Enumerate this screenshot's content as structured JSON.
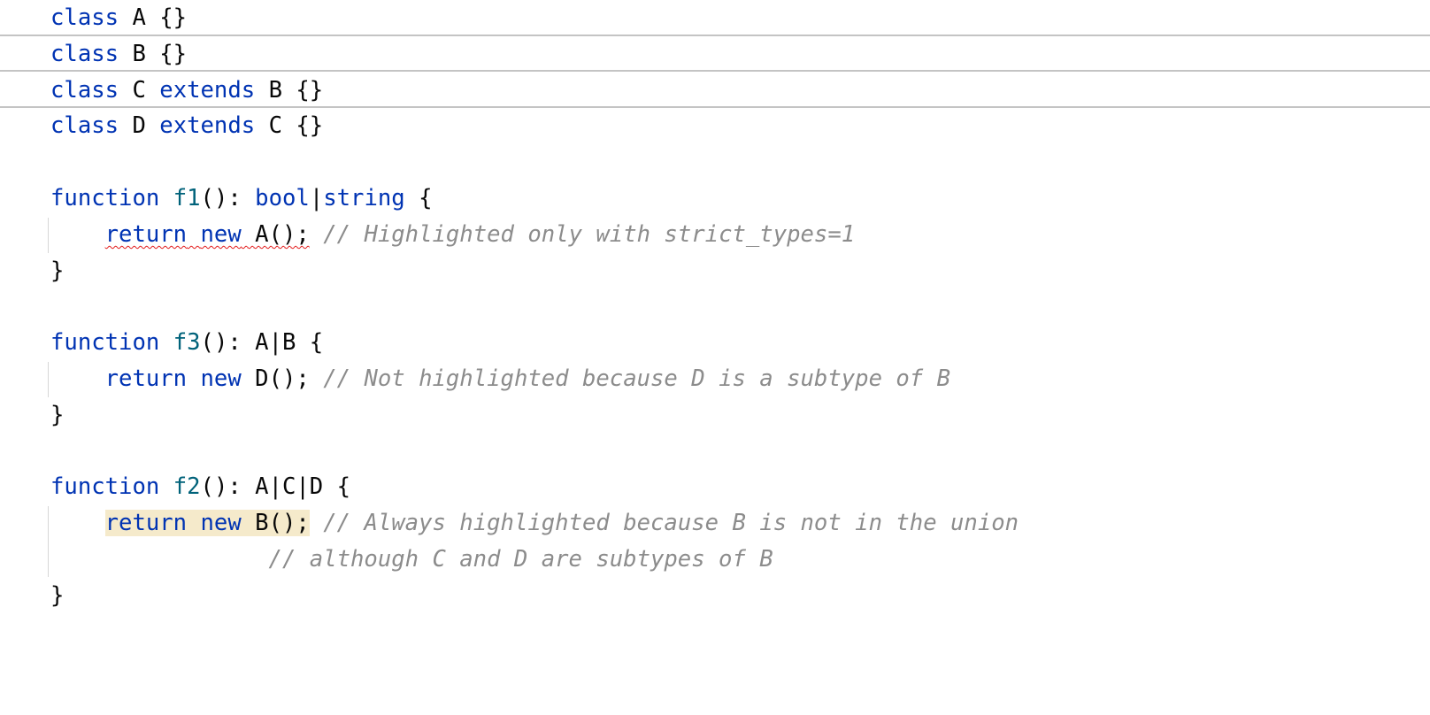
{
  "editor": {
    "lines": [
      {
        "tokens": [
          {
            "t": "kw",
            "v": "class"
          },
          {
            "t": "id",
            "v": " A {}"
          }
        ]
      },
      {
        "tokens": [
          {
            "t": "kw",
            "v": "class"
          },
          {
            "t": "id",
            "v": " B {}"
          }
        ]
      },
      {
        "tokens": [
          {
            "t": "kw",
            "v": "class"
          },
          {
            "t": "id",
            "v": " C "
          },
          {
            "t": "kw",
            "v": "extends"
          },
          {
            "t": "id",
            "v": " B {}"
          }
        ]
      },
      {
        "tokens": [
          {
            "t": "kw",
            "v": "class"
          },
          {
            "t": "id",
            "v": " D "
          },
          {
            "t": "kw",
            "v": "extends"
          },
          {
            "t": "id",
            "v": " C {}"
          }
        ]
      },
      {
        "tokens": []
      },
      {
        "tokens": [
          {
            "t": "kw",
            "v": "function"
          },
          {
            "t": "id",
            "v": " "
          },
          {
            "t": "fn",
            "v": "f1"
          },
          {
            "t": "id",
            "v": "(): "
          },
          {
            "t": "kw",
            "v": "bool"
          },
          {
            "t": "id",
            "v": "|"
          },
          {
            "t": "kw",
            "v": "string"
          },
          {
            "t": "id",
            "v": " {"
          }
        ]
      },
      {
        "tokens": [
          {
            "t": "id",
            "v": "    "
          },
          {
            "t": "kw",
            "v": "return"
          },
          {
            "t": "id",
            "v": " "
          },
          {
            "t": "kw",
            "v": "new"
          },
          {
            "t": "id",
            "v": " A();"
          },
          {
            "t": "id",
            "v": " "
          },
          {
            "t": "cm",
            "v": "// Highlighted only with strict_types=1"
          }
        ],
        "error_span": [
          1,
          4
        ]
      },
      {
        "tokens": [
          {
            "t": "id",
            "v": "}"
          }
        ]
      },
      {
        "tokens": []
      },
      {
        "tokens": [
          {
            "t": "kw",
            "v": "function"
          },
          {
            "t": "id",
            "v": " "
          },
          {
            "t": "fn",
            "v": "f3"
          },
          {
            "t": "id",
            "v": "(): A|B {"
          }
        ]
      },
      {
        "tokens": [
          {
            "t": "id",
            "v": "    "
          },
          {
            "t": "kw",
            "v": "return"
          },
          {
            "t": "id",
            "v": " "
          },
          {
            "t": "kw",
            "v": "new"
          },
          {
            "t": "id",
            "v": " D();"
          },
          {
            "t": "id",
            "v": " "
          },
          {
            "t": "cm",
            "v": "// Not highlighted because D is a subtype of B"
          }
        ]
      },
      {
        "tokens": [
          {
            "t": "id",
            "v": "}"
          }
        ]
      },
      {
        "tokens": []
      },
      {
        "tokens": [
          {
            "t": "kw",
            "v": "function"
          },
          {
            "t": "id",
            "v": " "
          },
          {
            "t": "fn",
            "v": "f2"
          },
          {
            "t": "id",
            "v": "(): A|C|D {"
          }
        ]
      },
      {
        "tokens": [
          {
            "t": "id",
            "v": "    "
          },
          {
            "t": "kw",
            "v": "return"
          },
          {
            "t": "id",
            "v": " "
          },
          {
            "t": "kw",
            "v": "new"
          },
          {
            "t": "id",
            "v": " B();"
          },
          {
            "t": "id",
            "v": " "
          },
          {
            "t": "cm",
            "v": "// Always highlighted because B is not in the union"
          }
        ],
        "warn_span": [
          1,
          4
        ]
      },
      {
        "tokens": [
          {
            "t": "id",
            "v": "                "
          },
          {
            "t": "cm",
            "v": "// although C and D are subtypes of B"
          }
        ]
      },
      {
        "tokens": [
          {
            "t": "id",
            "v": "}"
          }
        ]
      }
    ],
    "colors": {
      "keyword": "#0033b3",
      "function_name": "#00627a",
      "identifier": "#080808",
      "comment": "#8c8c8c",
      "error_underline": "#e31b1b",
      "warning_background": "#f5eacb",
      "separator": "#c4c4c4"
    }
  }
}
